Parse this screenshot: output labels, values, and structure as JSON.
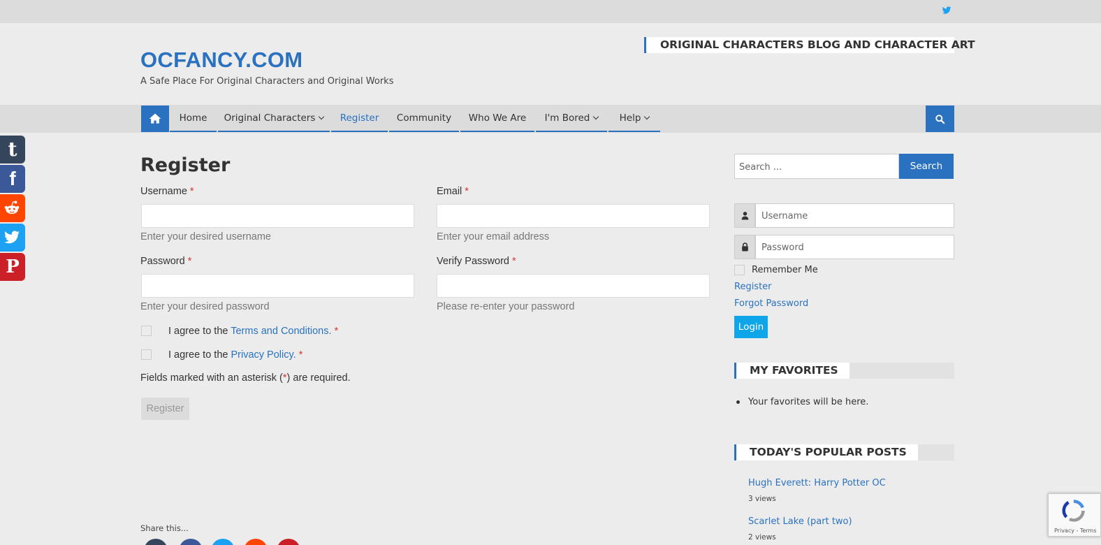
{
  "header": {
    "site_title": "OCFANCY.COM",
    "tagline": "A Safe Place For Original Characters and Original Works",
    "widget_title": "ORIGINAL CHARACTERS BLOG AND CHARACTER ART"
  },
  "nav": {
    "items": [
      {
        "label": "Home",
        "dropdown": false,
        "active": false
      },
      {
        "label": "Original Characters",
        "dropdown": true,
        "active": false
      },
      {
        "label": "Register",
        "dropdown": false,
        "active": true
      },
      {
        "label": "Community",
        "dropdown": false,
        "active": false
      },
      {
        "label": "Who We Are",
        "dropdown": false,
        "active": false
      },
      {
        "label": "I'm Bored",
        "dropdown": true,
        "active": false
      },
      {
        "label": "Help",
        "dropdown": true,
        "active": false
      }
    ]
  },
  "share_bar": [
    "tumblr-icon",
    "facebook-icon",
    "reddit-icon",
    "twitter-icon",
    "pinterest-icon"
  ],
  "form": {
    "title": "Register",
    "username_label": "Username",
    "username_help": "Enter your desired username",
    "email_label": "Email",
    "email_help": "Enter your email address",
    "password_label": "Password",
    "password_help": "Enter your desired password",
    "verify_label": "Verify Password",
    "verify_help": "Please re-enter your password",
    "required_mark": "*",
    "terms_prefix": "I agree to the",
    "terms_link": "Terms and Conditions.",
    "privacy_prefix": "I agree to the",
    "privacy_link": "Privacy Policy.",
    "note_before": "Fields marked with an asterisk (",
    "note_after": ") are required.",
    "submit_label": "Register"
  },
  "share_this": "Share this...",
  "sidebar": {
    "search_placeholder": "Search ...",
    "search_button": "Search",
    "username_placeholder": "Username",
    "password_placeholder": "Password",
    "remember_me": "Remember Me",
    "register_link": "Register",
    "forgot_link": "Forgot Password",
    "login_button": "Login",
    "favorites_title": "MY FAVORITES",
    "favorites_empty": "Your favorites will be here.",
    "popular_title": "TODAY'S POPULAR POSTS",
    "popular_posts": [
      {
        "title": "Hugh Everett: Harry Potter OC",
        "views": "3 views"
      },
      {
        "title": "Scarlet Lake (part two)",
        "views": "2 views"
      }
    ]
  },
  "recaptcha": {
    "text": "Privacy - Terms"
  },
  "colors": {
    "accent": "#2a72c0",
    "login_button": "#0ea5e9",
    "tumblr": "#35465c",
    "facebook": "#3b5998",
    "reddit": "#ff4500",
    "twitter": "#1da1f2",
    "pinterest": "#cb2027"
  }
}
